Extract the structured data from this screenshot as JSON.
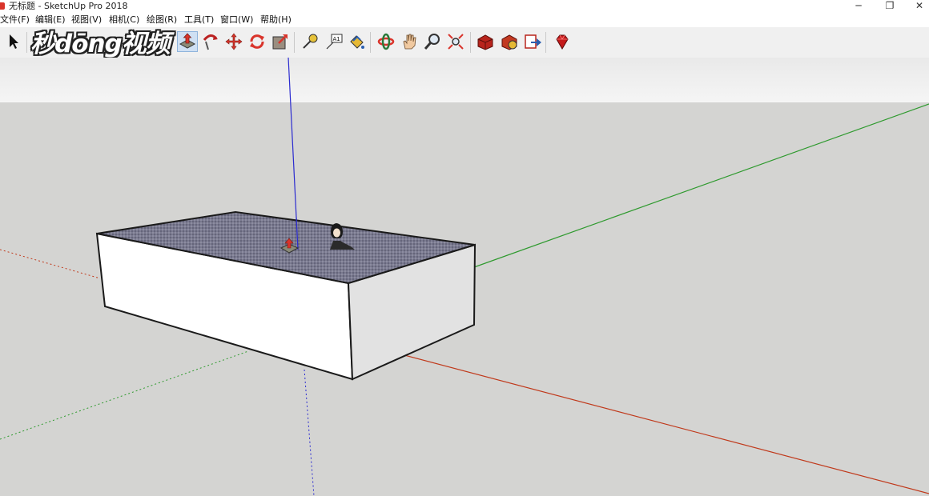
{
  "window": {
    "title": "无标题 - SketchUp Pro 2018",
    "minimize_glyph": "─",
    "restore_glyph": "❐",
    "close_glyph": "✕"
  },
  "menu": [
    {
      "label": "文件(F)"
    },
    {
      "label": "编辑(E)"
    },
    {
      "label": "视图(V)"
    },
    {
      "label": "相机(C)"
    },
    {
      "label": "绘图(R)"
    },
    {
      "label": "工具(T)"
    },
    {
      "label": "窗口(W)"
    },
    {
      "label": "帮助(H)"
    }
  ],
  "watermark": {
    "text": "秒dōng视频"
  },
  "toolbar": {
    "tools": [
      {
        "icon": "select-arrow-icon"
      },
      {
        "icon": "push-pull-icon",
        "active": true
      },
      {
        "icon": "follow-me-icon"
      },
      {
        "icon": "move-icon"
      },
      {
        "icon": "rotate-icon"
      },
      {
        "icon": "scale-icon"
      },
      {
        "icon": "tape-measure-icon"
      },
      {
        "icon": "text-icon",
        "text": "A1"
      },
      {
        "icon": "paint-bucket-icon"
      },
      {
        "icon": "orbit-icon"
      },
      {
        "icon": "pan-icon"
      },
      {
        "icon": "zoom-icon"
      },
      {
        "icon": "zoom-extents-icon"
      },
      {
        "icon": "3d-warehouse-icon"
      },
      {
        "icon": "extension-warehouse-icon"
      },
      {
        "icon": "send-to-layout-icon"
      },
      {
        "icon": "ruby-console-icon"
      }
    ]
  },
  "colors": {
    "sky": "#f1f1f1",
    "ground": "#d4d4d2",
    "red_axis": "#c0391b",
    "green_axis": "#2f9a2f",
    "blue_axis": "#2a2ad0",
    "box_top": "#6f6f86",
    "box_front": "#ffffff",
    "box_side": "#e4e4e4",
    "accent_red": "#d9342b"
  }
}
